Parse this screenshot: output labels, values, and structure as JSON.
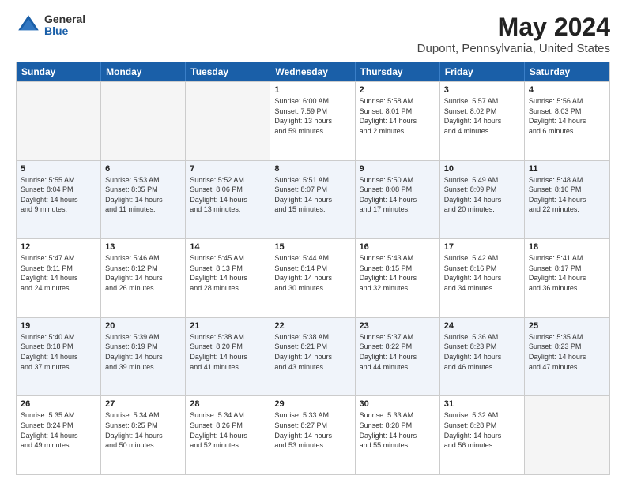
{
  "logo": {
    "general": "General",
    "blue": "Blue"
  },
  "title": "May 2024",
  "subtitle": "Dupont, Pennsylvania, United States",
  "days": [
    "Sunday",
    "Monday",
    "Tuesday",
    "Wednesday",
    "Thursday",
    "Friday",
    "Saturday"
  ],
  "rows": [
    [
      {
        "day": "",
        "text": "",
        "empty": true
      },
      {
        "day": "",
        "text": "",
        "empty": true
      },
      {
        "day": "",
        "text": "",
        "empty": true
      },
      {
        "day": "1",
        "text": "Sunrise: 6:00 AM\nSunset: 7:59 PM\nDaylight: 13 hours\nand 59 minutes."
      },
      {
        "day": "2",
        "text": "Sunrise: 5:58 AM\nSunset: 8:01 PM\nDaylight: 14 hours\nand 2 minutes."
      },
      {
        "day": "3",
        "text": "Sunrise: 5:57 AM\nSunset: 8:02 PM\nDaylight: 14 hours\nand 4 minutes."
      },
      {
        "day": "4",
        "text": "Sunrise: 5:56 AM\nSunset: 8:03 PM\nDaylight: 14 hours\nand 6 minutes."
      }
    ],
    [
      {
        "day": "5",
        "text": "Sunrise: 5:55 AM\nSunset: 8:04 PM\nDaylight: 14 hours\nand 9 minutes."
      },
      {
        "day": "6",
        "text": "Sunrise: 5:53 AM\nSunset: 8:05 PM\nDaylight: 14 hours\nand 11 minutes."
      },
      {
        "day": "7",
        "text": "Sunrise: 5:52 AM\nSunset: 8:06 PM\nDaylight: 14 hours\nand 13 minutes."
      },
      {
        "day": "8",
        "text": "Sunrise: 5:51 AM\nSunset: 8:07 PM\nDaylight: 14 hours\nand 15 minutes."
      },
      {
        "day": "9",
        "text": "Sunrise: 5:50 AM\nSunset: 8:08 PM\nDaylight: 14 hours\nand 17 minutes."
      },
      {
        "day": "10",
        "text": "Sunrise: 5:49 AM\nSunset: 8:09 PM\nDaylight: 14 hours\nand 20 minutes."
      },
      {
        "day": "11",
        "text": "Sunrise: 5:48 AM\nSunset: 8:10 PM\nDaylight: 14 hours\nand 22 minutes."
      }
    ],
    [
      {
        "day": "12",
        "text": "Sunrise: 5:47 AM\nSunset: 8:11 PM\nDaylight: 14 hours\nand 24 minutes."
      },
      {
        "day": "13",
        "text": "Sunrise: 5:46 AM\nSunset: 8:12 PM\nDaylight: 14 hours\nand 26 minutes."
      },
      {
        "day": "14",
        "text": "Sunrise: 5:45 AM\nSunset: 8:13 PM\nDaylight: 14 hours\nand 28 minutes."
      },
      {
        "day": "15",
        "text": "Sunrise: 5:44 AM\nSunset: 8:14 PM\nDaylight: 14 hours\nand 30 minutes."
      },
      {
        "day": "16",
        "text": "Sunrise: 5:43 AM\nSunset: 8:15 PM\nDaylight: 14 hours\nand 32 minutes."
      },
      {
        "day": "17",
        "text": "Sunrise: 5:42 AM\nSunset: 8:16 PM\nDaylight: 14 hours\nand 34 minutes."
      },
      {
        "day": "18",
        "text": "Sunrise: 5:41 AM\nSunset: 8:17 PM\nDaylight: 14 hours\nand 36 minutes."
      }
    ],
    [
      {
        "day": "19",
        "text": "Sunrise: 5:40 AM\nSunset: 8:18 PM\nDaylight: 14 hours\nand 37 minutes."
      },
      {
        "day": "20",
        "text": "Sunrise: 5:39 AM\nSunset: 8:19 PM\nDaylight: 14 hours\nand 39 minutes."
      },
      {
        "day": "21",
        "text": "Sunrise: 5:38 AM\nSunset: 8:20 PM\nDaylight: 14 hours\nand 41 minutes."
      },
      {
        "day": "22",
        "text": "Sunrise: 5:38 AM\nSunset: 8:21 PM\nDaylight: 14 hours\nand 43 minutes."
      },
      {
        "day": "23",
        "text": "Sunrise: 5:37 AM\nSunset: 8:22 PM\nDaylight: 14 hours\nand 44 minutes."
      },
      {
        "day": "24",
        "text": "Sunrise: 5:36 AM\nSunset: 8:23 PM\nDaylight: 14 hours\nand 46 minutes."
      },
      {
        "day": "25",
        "text": "Sunrise: 5:35 AM\nSunset: 8:23 PM\nDaylight: 14 hours\nand 47 minutes."
      }
    ],
    [
      {
        "day": "26",
        "text": "Sunrise: 5:35 AM\nSunset: 8:24 PM\nDaylight: 14 hours\nand 49 minutes."
      },
      {
        "day": "27",
        "text": "Sunrise: 5:34 AM\nSunset: 8:25 PM\nDaylight: 14 hours\nand 50 minutes."
      },
      {
        "day": "28",
        "text": "Sunrise: 5:34 AM\nSunset: 8:26 PM\nDaylight: 14 hours\nand 52 minutes."
      },
      {
        "day": "29",
        "text": "Sunrise: 5:33 AM\nSunset: 8:27 PM\nDaylight: 14 hours\nand 53 minutes."
      },
      {
        "day": "30",
        "text": "Sunrise: 5:33 AM\nSunset: 8:28 PM\nDaylight: 14 hours\nand 55 minutes."
      },
      {
        "day": "31",
        "text": "Sunrise: 5:32 AM\nSunset: 8:28 PM\nDaylight: 14 hours\nand 56 minutes."
      },
      {
        "day": "",
        "text": "",
        "empty": true
      }
    ]
  ]
}
